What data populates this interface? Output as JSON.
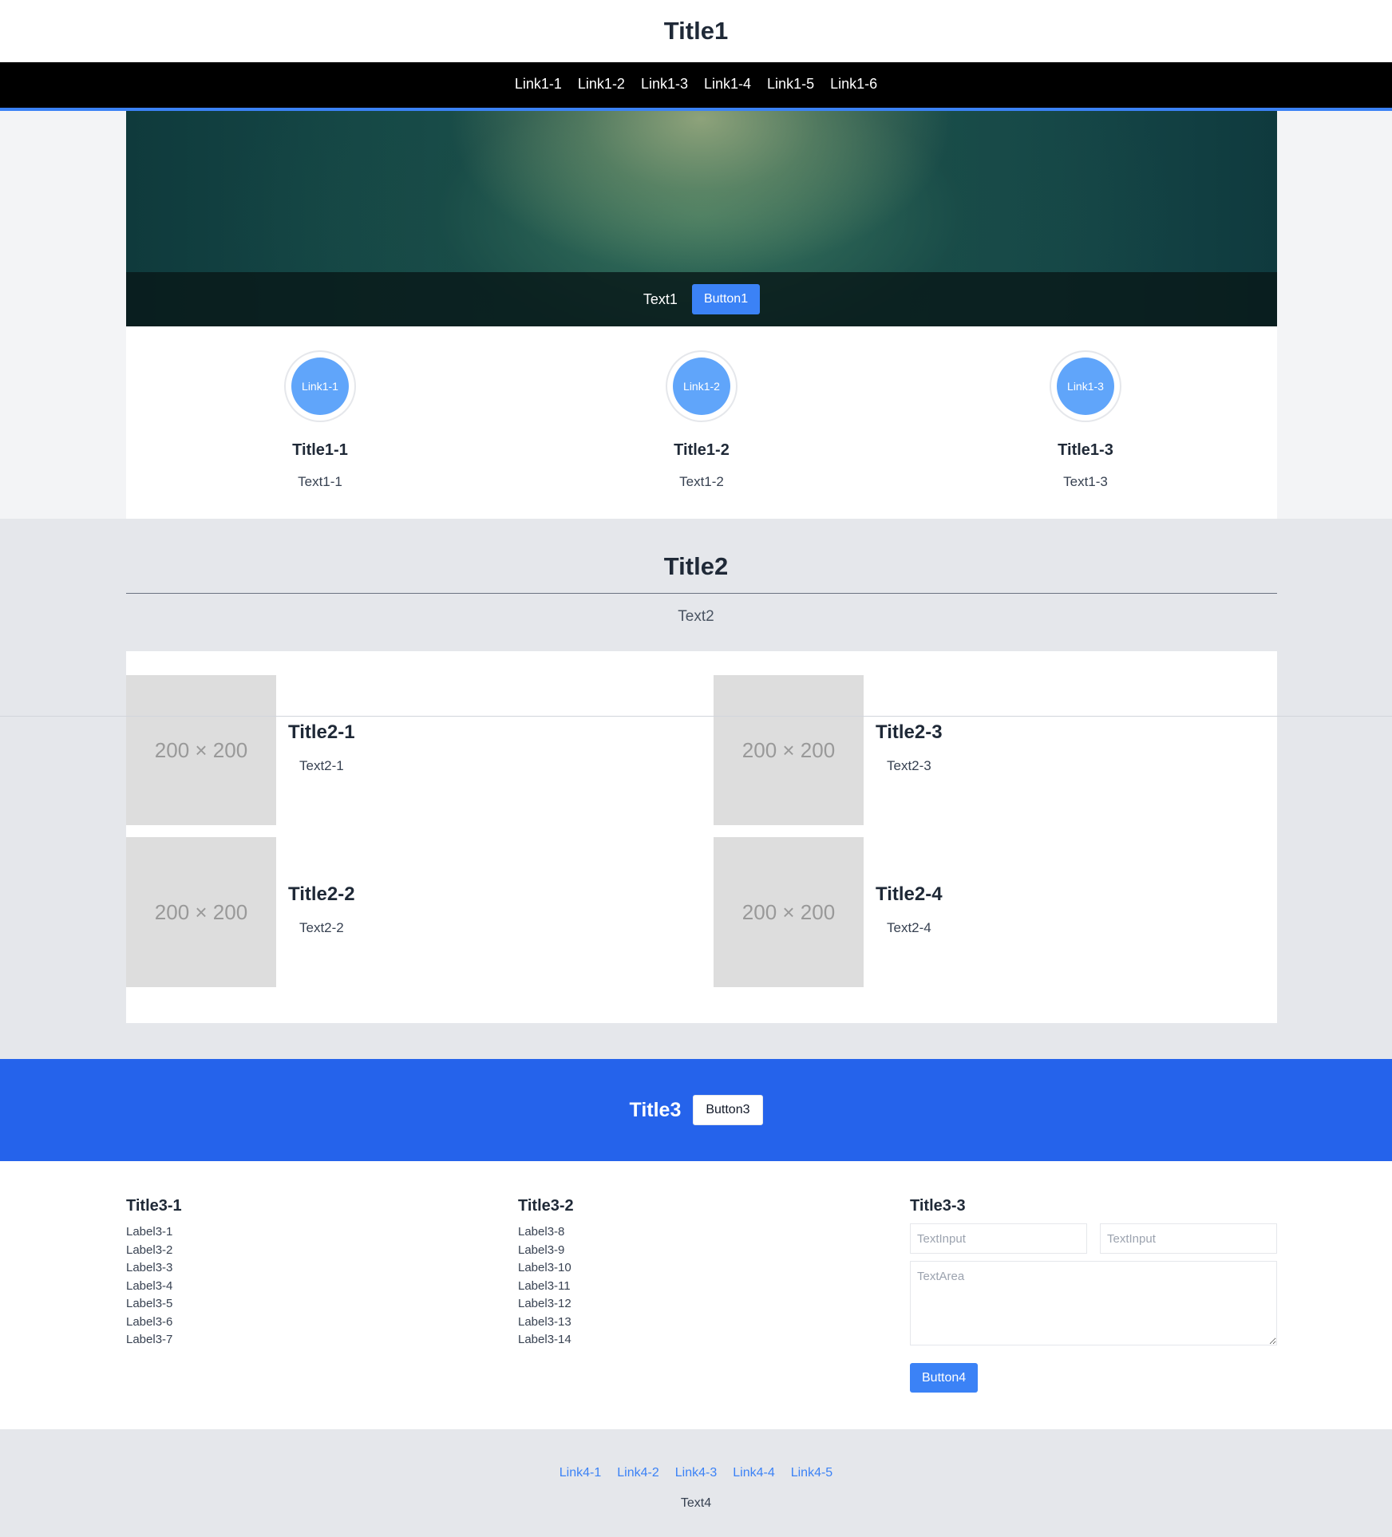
{
  "header": {
    "title": "Title1"
  },
  "nav": {
    "links": [
      "Link1-1",
      "Link1-2",
      "Link1-3",
      "Link1-4",
      "Link1-5",
      "Link1-6"
    ]
  },
  "hero": {
    "text": "Text1",
    "button": "Button1"
  },
  "features": [
    {
      "link": "Link1-1",
      "title": "Title1-1",
      "text": "Text1-1"
    },
    {
      "link": "Link1-2",
      "title": "Title1-2",
      "text": "Text1-2"
    },
    {
      "link": "Link1-3",
      "title": "Title1-3",
      "text": "Text1-3"
    }
  ],
  "section2": {
    "title": "Title2",
    "text": "Text2",
    "cards": [
      {
        "placeholder": "200 × 200",
        "title": "Title2-1",
        "text": "Text2-1"
      },
      {
        "placeholder": "200 × 200",
        "title": "Title2-2",
        "text": "Text2-2"
      },
      {
        "placeholder": "200 × 200",
        "title": "Title2-3",
        "text": "Text2-3"
      },
      {
        "placeholder": "200 × 200",
        "title": "Title2-4",
        "text": "Text2-4"
      }
    ]
  },
  "cta": {
    "title": "Title3",
    "button": "Button3"
  },
  "columns": {
    "col1": {
      "title": "Title3-1",
      "items": [
        "Label3-1",
        "Label3-2",
        "Label3-3",
        "Label3-4",
        "Label3-5",
        "Label3-6",
        "Label3-7"
      ]
    },
    "col2": {
      "title": "Title3-2",
      "items": [
        "Label3-8",
        "Label3-9",
        "Label3-10",
        "Label3-11",
        "Label3-12",
        "Label3-13",
        "Label3-14"
      ]
    },
    "form": {
      "title": "Title3-3",
      "input1_placeholder": "TextInput",
      "input2_placeholder": "TextInput",
      "textarea_placeholder": "TextArea",
      "button": "Button4"
    }
  },
  "footer": {
    "links": [
      "Link4-1",
      "Link4-2",
      "Link4-3",
      "Link4-4",
      "Link4-5"
    ],
    "text": "Text4"
  },
  "colors": {
    "accent": "#3b82f6",
    "cta_band": "#2563eb",
    "nav_bg": "#000000",
    "circle": "#60a5fa"
  }
}
